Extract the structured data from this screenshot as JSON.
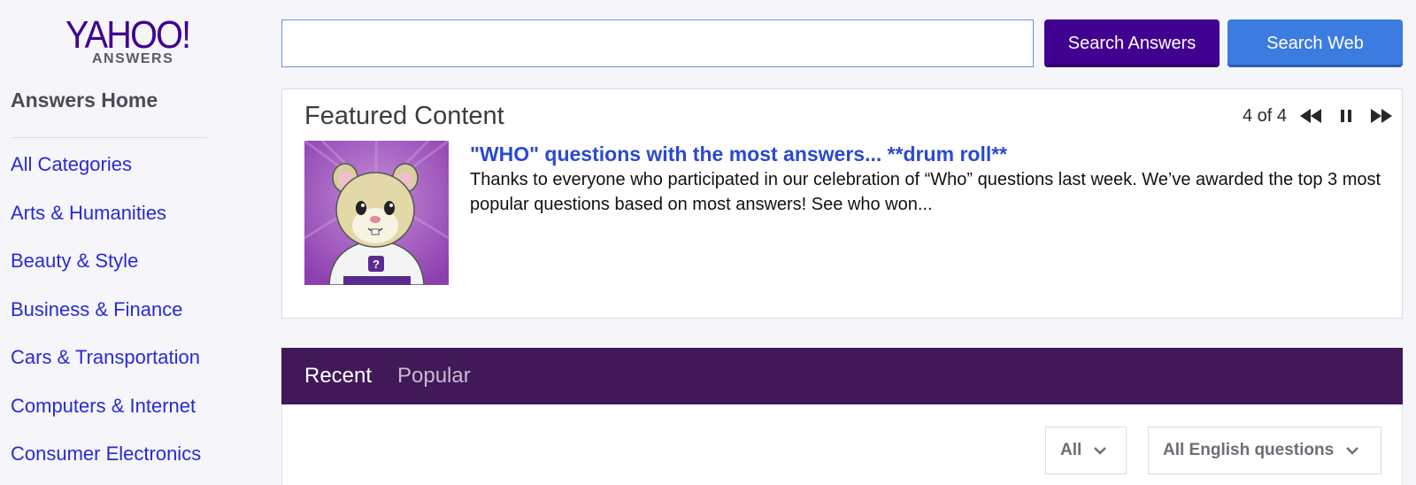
{
  "brand": {
    "logo_main": "YAHOO!",
    "logo_sub": "ANSWERS",
    "color": "#400090"
  },
  "sidebar": {
    "home_label": "Answers Home",
    "categories": [
      "All Categories",
      "Arts & Humanities",
      "Beauty & Style",
      "Business & Finance",
      "Cars & Transportation",
      "Computers & Internet",
      "Consumer Electronics"
    ]
  },
  "search": {
    "value": "",
    "placeholder": "",
    "answers_button": "Search Answers",
    "web_button": "Search Web"
  },
  "featured": {
    "title": "Featured Content",
    "pager": {
      "current": 4,
      "total": 4,
      "label": "4 of 4"
    },
    "headline": "\"WHO\" questions with the most answers... **drum roll**",
    "body": "Thanks to everyone who participated in our celebration of “Who” questions last week. We’ve awarded the top 3 most popular questions based on most answers! See who won..."
  },
  "tabs": [
    {
      "label": "Recent",
      "active": true
    },
    {
      "label": "Popular",
      "active": false
    }
  ],
  "filters": {
    "type_selected": "All",
    "language_selected": "All English questions"
  },
  "colors": {
    "accent_purple": "#400090",
    "tab_bar": "#411858",
    "web_blue": "#3c7be0",
    "link_blue": "#2a2ad2"
  }
}
